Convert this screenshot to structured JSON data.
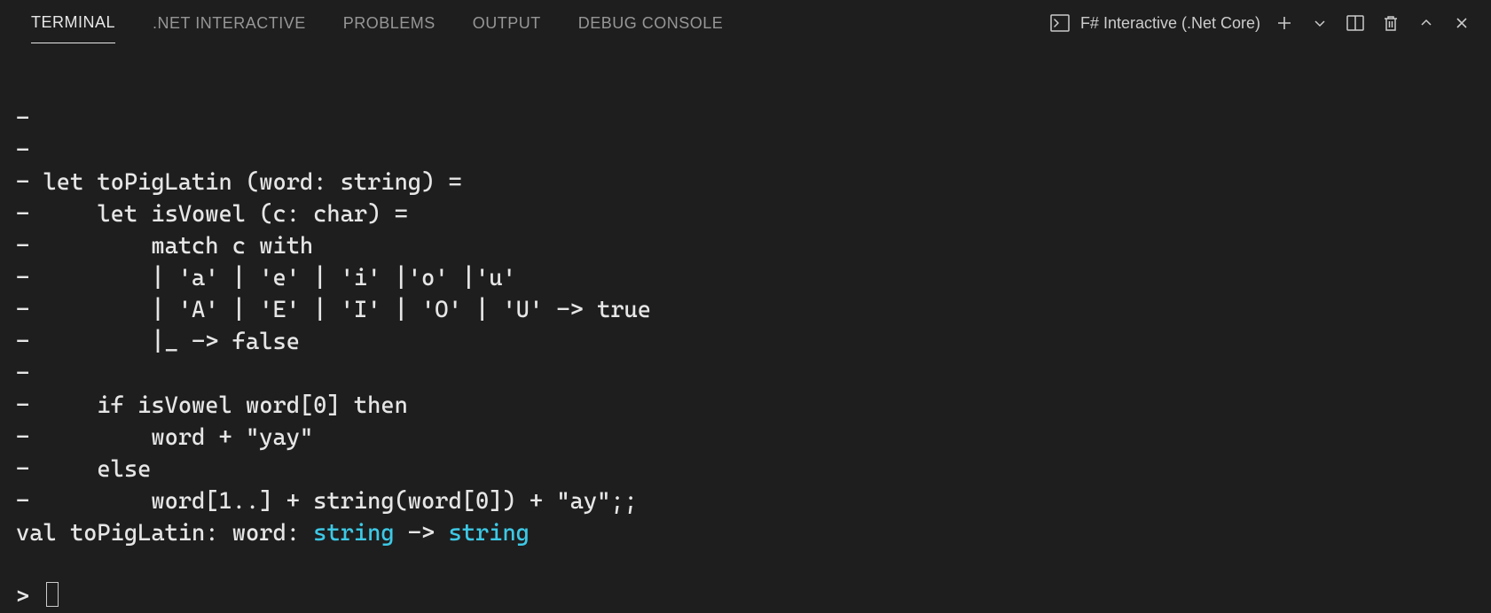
{
  "tabs": {
    "terminal": "TERMINAL",
    "dotnet": ".NET INTERACTIVE",
    "problems": "PROBLEMS",
    "output": "OUTPUT",
    "debug": "DEBUG CONSOLE"
  },
  "selector": {
    "label": "F# Interactive (.Net Core)"
  },
  "code": {
    "l1": "- ",
    "l2": "- ",
    "l3": "- let toPigLatin (word: string) =",
    "l4": "-     let isVowel (c: char) =",
    "l5": "-         match c with",
    "l6": "-         | 'a' | 'e' | 'i' |'o' |'u'",
    "l7": "-         | 'A' | 'E' | 'I' | 'O' | 'U' -> true",
    "l8": "-         |_ -> false",
    "l9": "- ",
    "l10": "-     if isVowel word[0] then",
    "l11": "-         word + \"yay\"",
    "l12": "-     else",
    "l13": "-         word[1..] + string(word[0]) + \"ay\";;",
    "val_prefix": "val toPigLatin: word: ",
    "val_t1": "string",
    "val_arrow": " -> ",
    "val_t2": "string",
    "prompt": "> "
  }
}
